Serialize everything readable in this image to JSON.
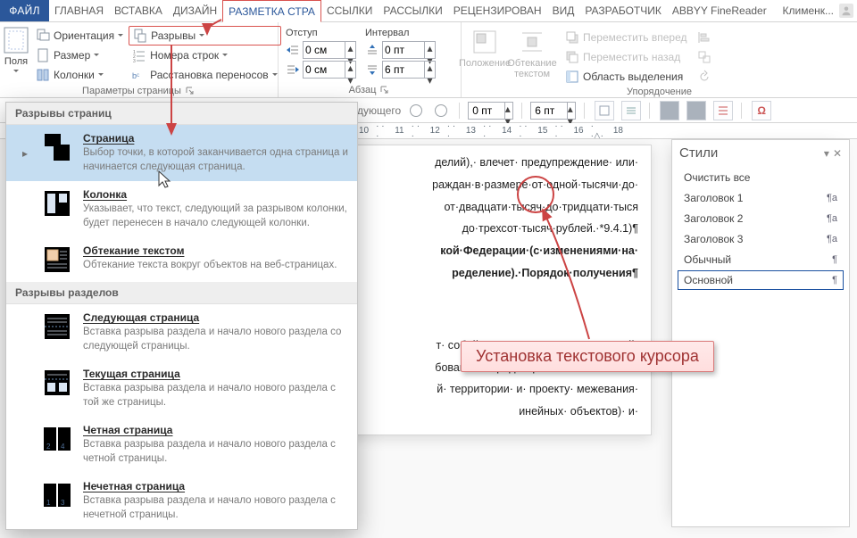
{
  "tabs": {
    "file": "ФАЙЛ",
    "items": [
      "ГЛАВНАЯ",
      "ВСТАВКА",
      "ДИЗАЙН",
      "РАЗМЕТКА СТРА",
      "ССЫЛКИ",
      "РАССЫЛКИ",
      "РЕЦЕНЗИРОВАН",
      "ВИД",
      "РАЗРАБОТЧИК",
      "ABBYY FineReader"
    ],
    "active_index": 3,
    "user": "Клименк..."
  },
  "ribbon": {
    "page_setup": {
      "label": "Параметры страницы",
      "margins": "Поля",
      "orientation": "Ориентация",
      "size": "Размер",
      "columns": "Колонки",
      "breaks": "Разрывы",
      "line_numbers": "Номера строк",
      "hyphenation": "Расстановка переносов"
    },
    "paragraph": {
      "label": "Абзац",
      "indent_label": "Отступ",
      "spacing_label": "Интервал",
      "indent_left": "0 см",
      "indent_right": "0 см",
      "space_before": "0 пт",
      "space_after": "6 пт"
    },
    "arrange": {
      "label": "Упорядочение",
      "position": "Положение",
      "wrap": "Обтекание текстом",
      "bring_forward": "Переместить вперед",
      "send_backward": "Переместить назад",
      "selection_pane": "Область выделения"
    }
  },
  "subbar": {
    "sp1": "0 пт",
    "sp2": "6 пт"
  },
  "ruler": {
    "marks": [
      "10",
      "11",
      "12",
      "13",
      "14",
      "15",
      "16",
      "",
      "18"
    ]
  },
  "breaks": {
    "header_pages": "Разрывы страниц",
    "header_sections": "Разрывы разделов",
    "items_pages": [
      {
        "title": "Страница",
        "desc": "Выбор точки, в которой заканчивается одна страница и начинается следующая страница."
      },
      {
        "title": "Колонка",
        "desc": "Указывает, что текст, следующий за разрывом колонки, будет перенесен в начало следующей колонки."
      },
      {
        "title": "Обтекание текстом",
        "desc": "Обтекание текста вокруг объектов на веб-страницах."
      }
    ],
    "items_sections": [
      {
        "title": "Следующая страница",
        "desc": "Вставка разрыва раздела и начало нового раздела со следующей страницы."
      },
      {
        "title": "Текущая страница",
        "desc": "Вставка разрыва раздела и начало нового раздела с той же страницы."
      },
      {
        "title": "Четная страница",
        "desc": "Вставка разрыва раздела и начало нового раздела с четной страницы."
      },
      {
        "title": "Нечетная страница",
        "desc": "Вставка разрыва раздела и начало нового раздела с нечетной страницы."
      }
    ]
  },
  "styles": {
    "title": "Стили",
    "items": [
      {
        "name": "Очистить все",
        "sym": ""
      },
      {
        "name": "Заголовок 1",
        "sym": "¶a"
      },
      {
        "name": "Заголовок 2",
        "sym": "¶a"
      },
      {
        "name": "Заголовок 3",
        "sym": "¶a"
      },
      {
        "name": "Обычный",
        "sym": "¶"
      },
      {
        "name": "Основной",
        "sym": "¶"
      }
    ],
    "selected_index": 5
  },
  "doc": {
    "p1": "делий),· влечет· предупреждение· или·",
    "p2": "раждан·в·размере·от·одной·тысячи·до·",
    "p3": "от·двадцати·тысяч·до·тридцати·тыся",
    "p4": "до·трехсот·тысяч·рублей.·*9.4.1)¶",
    "p5": "кой·Федерации·(с·изменениями·на·",
    "p6": "ределение).·Порядок·получения¶",
    "p7": "т· собой· документ,· подтверждающий·",
    "p8": "бованиям· градостроительного· плана·",
    "p9": "й· территории· и· проекту· межевания·",
    "p10": "инейных· объектов)· и·"
  },
  "annotation": {
    "callout": "Установка текстового курсора"
  }
}
